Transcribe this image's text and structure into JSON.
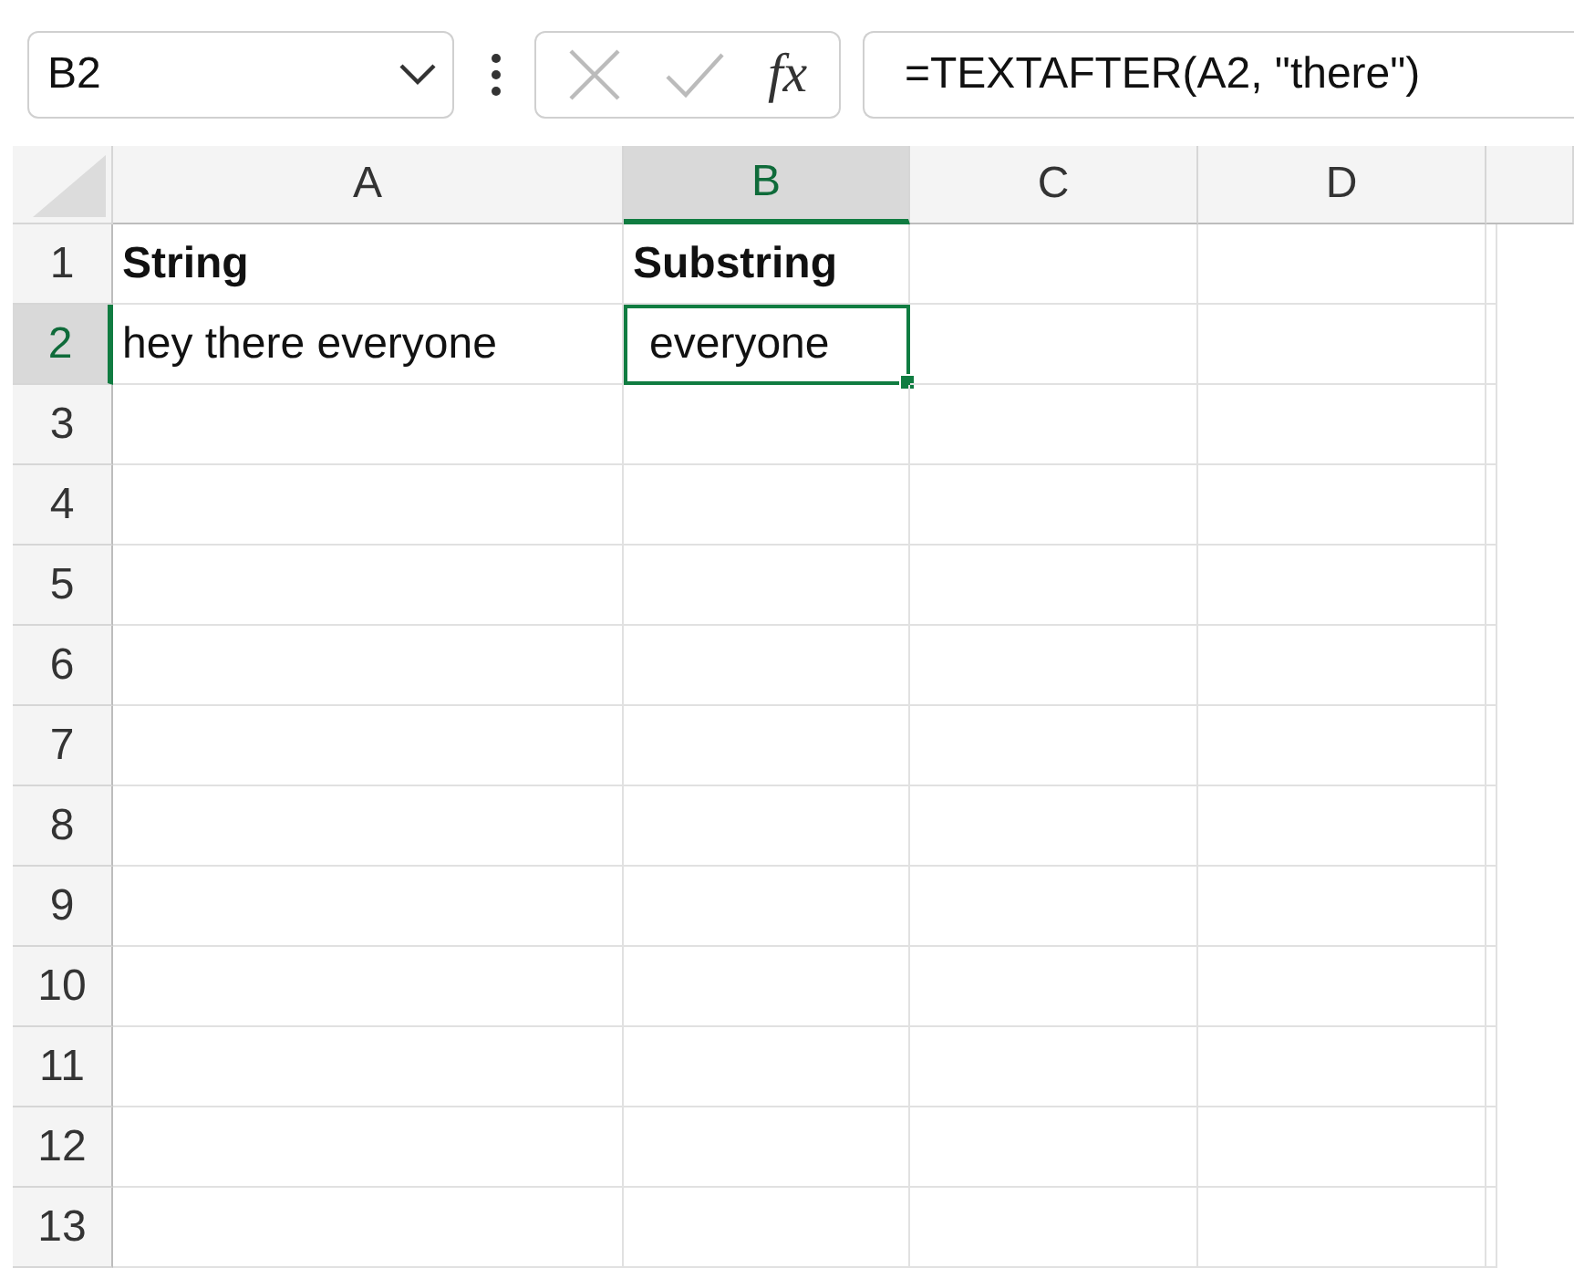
{
  "name_box": {
    "value": "B2"
  },
  "formula_bar": {
    "function_label": "fx",
    "formula": "=TEXTAFTER(A2, \"there\")"
  },
  "columns": [
    {
      "label": "A",
      "selected": false
    },
    {
      "label": "B",
      "selected": true
    },
    {
      "label": "C",
      "selected": false
    },
    {
      "label": "D",
      "selected": false
    }
  ],
  "rows": [
    {
      "label": "1",
      "selected": false,
      "cells": [
        {
          "text": "String",
          "bold": true,
          "selected": false
        },
        {
          "text": "Substring",
          "bold": true,
          "selected": false
        }
      ]
    },
    {
      "label": "2",
      "selected": true,
      "cells": [
        {
          "text": "hey there everyone",
          "bold": false,
          "selected": false
        },
        {
          "text": "everyone",
          "bold": false,
          "selected": true
        }
      ]
    },
    {
      "label": "3",
      "selected": false,
      "cells": []
    },
    {
      "label": "4",
      "selected": false,
      "cells": []
    },
    {
      "label": "5",
      "selected": false,
      "cells": []
    },
    {
      "label": "6",
      "selected": false,
      "cells": []
    },
    {
      "label": "7",
      "selected": false,
      "cells": []
    },
    {
      "label": "8",
      "selected": false,
      "cells": []
    },
    {
      "label": "9",
      "selected": false,
      "cells": []
    },
    {
      "label": "10",
      "selected": false,
      "cells": []
    },
    {
      "label": "11",
      "selected": false,
      "cells": []
    },
    {
      "label": "12",
      "selected": false,
      "cells": []
    },
    {
      "label": "13",
      "selected": false,
      "cells": []
    }
  ]
}
